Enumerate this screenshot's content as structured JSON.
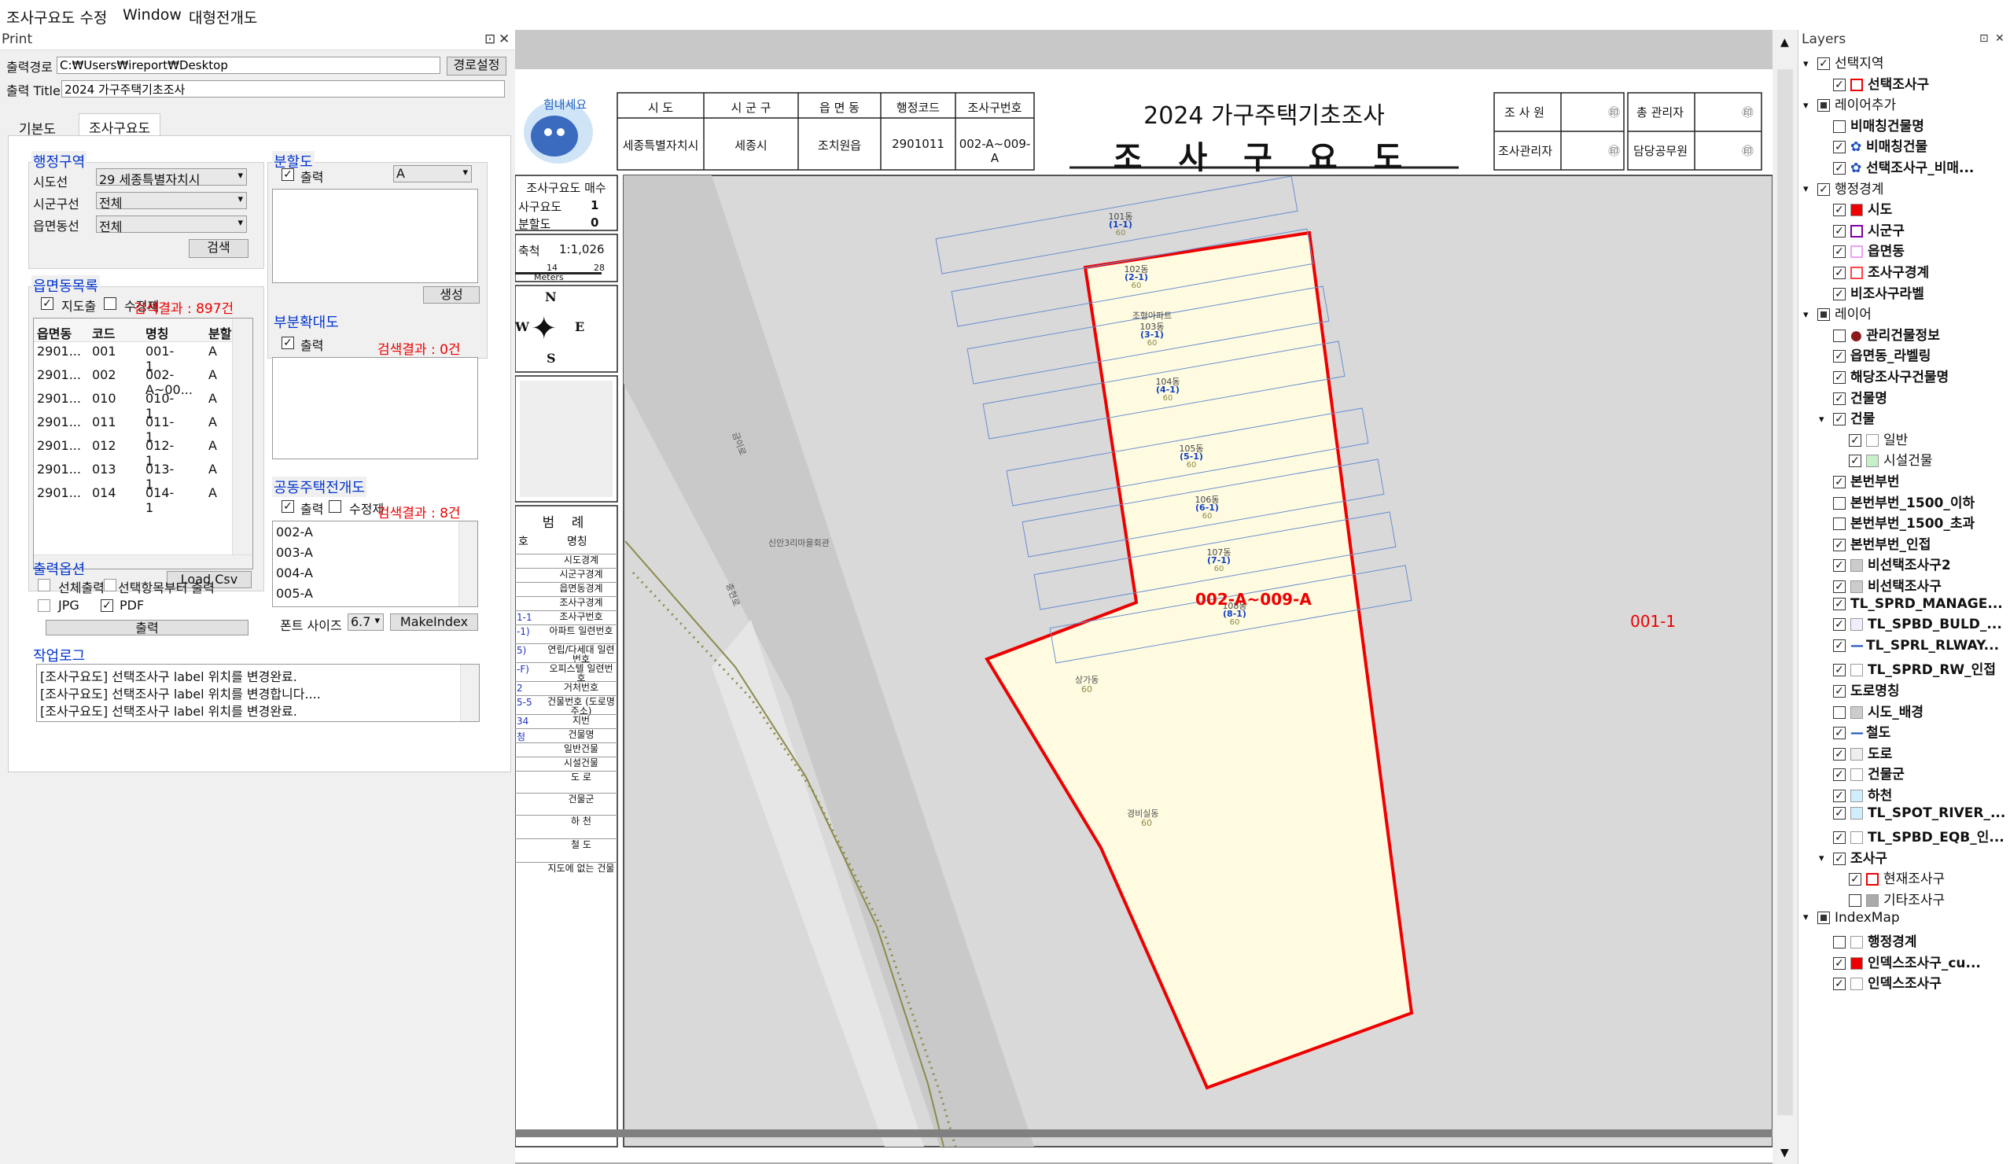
{
  "menu": {
    "items": [
      "조사구요도 수정",
      "Window",
      "대형전개도"
    ]
  },
  "print": {
    "title": "Print",
    "output_path_label": "출력경로",
    "output_path_value": "C:₩Users₩ireport₩Desktop",
    "path_button": "경로설정",
    "output_title_label": "출력 Title",
    "output_title_value": "2024 가구주택기초조사",
    "tabs": [
      "기본도",
      "조사구요도"
    ],
    "admin": {
      "title": "행정구역",
      "sido_label": "시도선",
      "sido_value": "29 세종특별자치시",
      "sigungu_label": "시군구선",
      "sigungu_value": "전체",
      "emd_label": "읍면동선",
      "emd_value": "전체",
      "search_button": "검색"
    },
    "emd_list": {
      "title": "읍면동목록",
      "map_out_label": "지도출",
      "edit_label": "수정제",
      "result": "검색결과 : 897건",
      "columns": [
        "읍면동",
        "코드",
        "명칭",
        "분할"
      ],
      "rows": [
        [
          "2901...",
          "001",
          "001-1",
          "A"
        ],
        [
          "2901...",
          "002",
          "002-A~00...",
          "A"
        ],
        [
          "2901...",
          "010",
          "010-1",
          "A"
        ],
        [
          "2901...",
          "011",
          "011-1",
          "A"
        ],
        [
          "2901...",
          "012",
          "012-1",
          "A"
        ],
        [
          "2901...",
          "013",
          "013-1",
          "A"
        ],
        [
          "2901...",
          "014",
          "014-1",
          "A"
        ]
      ],
      "load_button": "Load Csv"
    },
    "split": {
      "title": "분할도",
      "out_label": "출력",
      "select": "A",
      "create_button": "생성"
    },
    "partial": {
      "title": "부분확대도",
      "out_label": "출력",
      "result": "검색결과 : 0건"
    },
    "apt": {
      "title": "공동주택전개도",
      "out_label": "출력",
      "edit_label": "수정제",
      "result": "검색결과 : 8건",
      "items": [
        "002-A",
        "003-A",
        "004-A",
        "005-A"
      ],
      "font_label": "폰트 사이즈",
      "font_value": "6.7",
      "make_button": "MakeIndex"
    },
    "options": {
      "title": "출력옵션",
      "opt1": "선체출력",
      "opt2": "선택항목부터 출력",
      "opt3": "JPG",
      "opt4": "PDF",
      "print_button": "출력"
    },
    "log": {
      "title": "작업로그",
      "lines": [
        "[조사구요도] 선택조사구 label 위치를 변경완료.",
        "[조사구요도] 선택조사구 label 위치를 변경합니다....",
        "[조사구요도] 선택조사구 label 위치를 변경완료."
      ]
    }
  },
  "sheet": {
    "logo": "힘내세요",
    "header_cols": [
      "시 도",
      "시 군 구",
      "읍 면 동",
      "행정코드",
      "조사구번호"
    ],
    "header_vals": [
      "세종특별자치시",
      "세종시",
      "조치원읍",
      "2901011",
      "002-A~009-A"
    ],
    "title": "2024 가구주택기초조사",
    "subtitle": "조 사 구 요 도",
    "sign": [
      "조 사 원",
      "총 관리자",
      "조사관리자",
      "담당공무원"
    ],
    "seal": "㊞",
    "count_title": "조사구요도 매수",
    "count_rows": [
      [
        "사구요도",
        "1"
      ],
      [
        "분할도",
        "0"
      ]
    ],
    "scale_label": "축척",
    "scale_value": "1:1,026",
    "scale_ticks": [
      "0",
      "14",
      "28"
    ],
    "scale_unit": "Meters",
    "compass": [
      "N",
      "S",
      "W",
      "E"
    ],
    "legend_title": "범 례",
    "legend_head": [
      "호",
      "명칭"
    ],
    "legend": [
      [
        "",
        "시도경계"
      ],
      [
        "",
        "시군구경계"
      ],
      [
        "",
        "읍면동경계"
      ],
      [
        "",
        "조사구경계"
      ],
      [
        "1-1",
        "조사구번호"
      ],
      [
        "-1)",
        "아파트 일련번호"
      ],
      [
        "5)",
        "연립/다세대 일련번호"
      ],
      [
        "-F)",
        "오피스텔 일련번호"
      ],
      [
        "2",
        "거처번호"
      ],
      [
        "5-5",
        "건물번호 (도로명주소)"
      ],
      [
        "34",
        "지번"
      ],
      [
        "청",
        "건물명"
      ],
      [
        "",
        "일반건물"
      ],
      [
        "",
        "시설건물"
      ],
      [
        "",
        "도 로"
      ],
      [
        "",
        "건물군"
      ],
      [
        "",
        "하 천"
      ],
      [
        "",
        "철 도"
      ],
      [
        "",
        "지도에 없는 건물"
      ]
    ]
  },
  "map": {
    "region_label": "002-A~009-A",
    "other_label": "001-1",
    "village": "신안3리마을회관",
    "road1": "금이로",
    "road2": "충현로",
    "buildings": [
      {
        "name": "101동",
        "num": "(1-1)",
        "no": "60"
      },
      {
        "name": "102동",
        "num": "(2-1)",
        "no": "60"
      },
      {
        "name": "103동",
        "num": "(3-1)",
        "no": "60",
        "extra": "조형아파트"
      },
      {
        "name": "104동",
        "num": "(4-1)",
        "no": "60"
      },
      {
        "name": "105동",
        "num": "(5-1)",
        "no": "60"
      },
      {
        "name": "106동",
        "num": "(6-1)",
        "no": "60"
      },
      {
        "name": "107동",
        "num": "(7-1)",
        "no": "60"
      },
      {
        "name": "108동",
        "num": "(8-1)",
        "no": "60"
      }
    ],
    "shop": {
      "name": "상가동",
      "no": "60"
    },
    "guard": {
      "name": "경비실동",
      "no": "60"
    }
  },
  "layers": {
    "title": "Layers",
    "items": [
      {
        "t": "선택지역",
        "d": 0,
        "c": true,
        "tw": "▾"
      },
      {
        "t": "선택조사구",
        "d": 1,
        "c": true,
        "sw": "#fff",
        "swb": "#e00",
        "b": true
      },
      {
        "t": "레이어추가",
        "d": 0,
        "c": "p",
        "tw": "▾"
      },
      {
        "t": "비매칭건물명",
        "d": 1,
        "c": false,
        "b": true
      },
      {
        "t": "비매칭건물",
        "d": 1,
        "c": true,
        "ic": "✿",
        "b": true
      },
      {
        "t": "선택조사구_비매...",
        "d": 1,
        "c": true,
        "ic": "✿",
        "b": true
      },
      {
        "t": "행정경계",
        "d": 0,
        "c": true,
        "tw": "▾"
      },
      {
        "t": "시도",
        "d": 1,
        "c": true,
        "sw": "#e00",
        "b": true
      },
      {
        "t": "시군구",
        "d": 1,
        "c": true,
        "sw": "#fff",
        "swb": "#8000a0",
        "b": true
      },
      {
        "t": "읍면동",
        "d": 1,
        "c": true,
        "sw": "#fff",
        "swb": "#f0a0f0",
        "b": true
      },
      {
        "t": "조사구경계",
        "d": 1,
        "c": true,
        "sw": "#fff",
        "swb": "#ff4444",
        "b": true
      },
      {
        "t": "비조사구라벨",
        "d": 1,
        "c": true,
        "b": true
      },
      {
        "t": "레이어",
        "d": 0,
        "c": "p",
        "tw": "▾"
      },
      {
        "t": "관리건물정보",
        "d": 1,
        "c": false,
        "ic": "●",
        "b": true
      },
      {
        "t": "읍면동_라벨링",
        "d": 1,
        "c": true,
        "b": true
      },
      {
        "t": "해당조사구건물명",
        "d": 1,
        "c": true,
        "b": true
      },
      {
        "t": "건물명",
        "d": 1,
        "c": true,
        "b": true
      },
      {
        "t": "건물",
        "d": 1,
        "c": true,
        "tw": "▾",
        "b": true
      },
      {
        "t": "일반",
        "d": 2,
        "c": true,
        "sw": "#fff"
      },
      {
        "t": "시설건물",
        "d": 2,
        "c": true,
        "sw": "#c8f0c8"
      },
      {
        "t": "본번부번",
        "d": 1,
        "c": true,
        "b": true
      },
      {
        "t": "본번부번_1500_이하",
        "d": 1,
        "c": false,
        "b": true
      },
      {
        "t": "본번부번_1500_초과",
        "d": 1,
        "c": false,
        "b": true
      },
      {
        "t": "본번부번_인접",
        "d": 1,
        "c": true,
        "b": true
      },
      {
        "t": "비선택조사구2",
        "d": 1,
        "c": true,
        "sw": "#ccc",
        "b": true
      },
      {
        "t": "비선택조사구",
        "d": 1,
        "c": true,
        "sw": "#ccc",
        "b": true
      },
      {
        "t": "TL_SPRD_MANAGE...",
        "d": 1,
        "c": true,
        "b": true
      },
      {
        "t": "TL_SPBD_BULD_...",
        "d": 1,
        "c": true,
        "sw": "#eef",
        "b": true
      },
      {
        "t": "TL_SPRL_RLWAY...",
        "d": 1,
        "c": true,
        "ic": "—",
        "b": true
      },
      {
        "t": "TL_SPRD_RW_인접",
        "d": 1,
        "c": true,
        "sw": "#fff",
        "b": true
      },
      {
        "t": "도로명칭",
        "d": 1,
        "c": true,
        "b": true
      },
      {
        "t": "시도_배경",
        "d": 1,
        "c": false,
        "sw": "#ccc",
        "b": true
      },
      {
        "t": "철도",
        "d": 1,
        "c": true,
        "ic": "—",
        "b": true
      },
      {
        "t": "도로",
        "d": 1,
        "c": true,
        "sw": "#eee",
        "b": true
      },
      {
        "t": "건물군",
        "d": 1,
        "c": true,
        "sw": "#fff",
        "b": true
      },
      {
        "t": "하천",
        "d": 1,
        "c": true,
        "sw": "#cfefff",
        "b": true
      },
      {
        "t": "TL_SPOT_RIVER_...",
        "d": 1,
        "c": true,
        "sw": "#cfefff",
        "b": true
      },
      {
        "t": "TL_SPBD_EQB_인...",
        "d": 1,
        "c": true,
        "sw": "#fff",
        "b": true
      },
      {
        "t": "조사구",
        "d": 1,
        "c": true,
        "tw": "▾",
        "b": true
      },
      {
        "t": "현재조사구",
        "d": 2,
        "c": true,
        "sw": "#fff",
        "swb": "#e00"
      },
      {
        "t": "기타조사구",
        "d": 2,
        "c": false,
        "sw": "#aaa"
      },
      {
        "t": "IndexMap",
        "d": 0,
        "c": "p",
        "tw": "▾"
      },
      {
        "t": "행정경계",
        "d": 1,
        "c": false,
        "sw": "#fff",
        "b": true
      },
      {
        "t": "인덱스조사구_cu...",
        "d": 1,
        "c": true,
        "sw": "#e00",
        "b": true
      },
      {
        "t": "인덱스조사구",
        "d": 1,
        "c": true,
        "sw": "#fff",
        "b": true
      }
    ]
  }
}
